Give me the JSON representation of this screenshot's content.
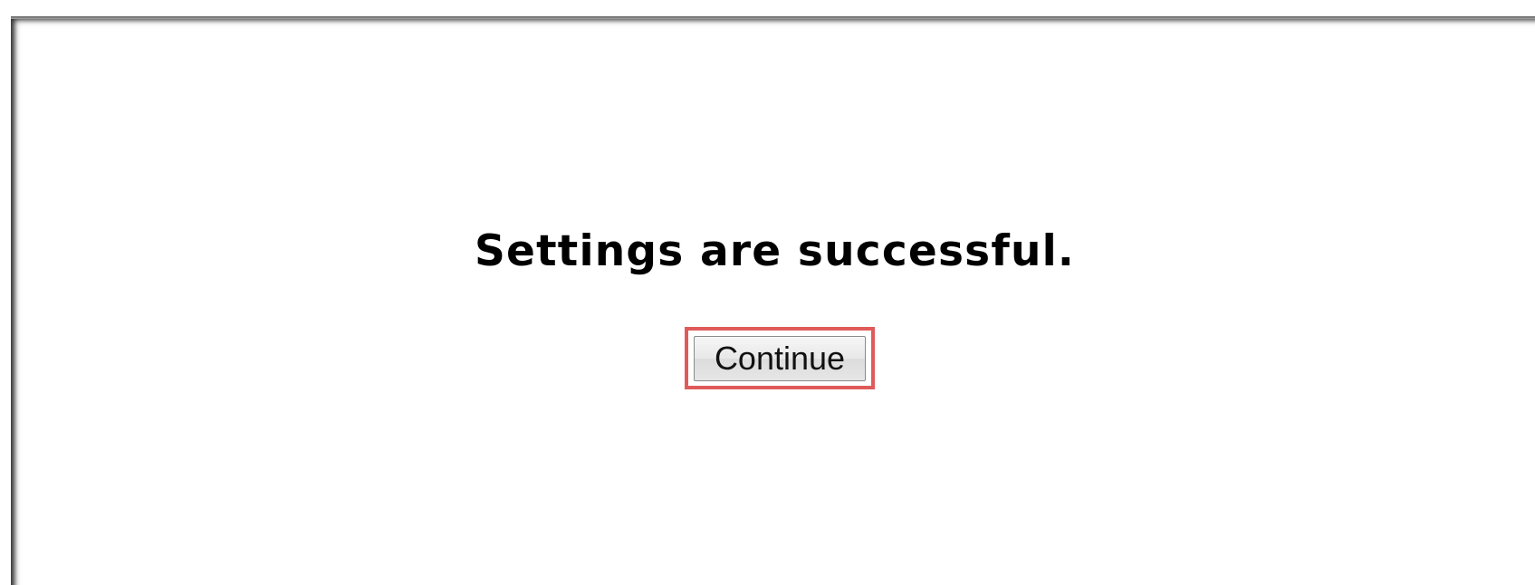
{
  "dialog": {
    "message": "Settings are successful.",
    "continue_label": "Continue",
    "highlight_color": "#e05a5a"
  }
}
